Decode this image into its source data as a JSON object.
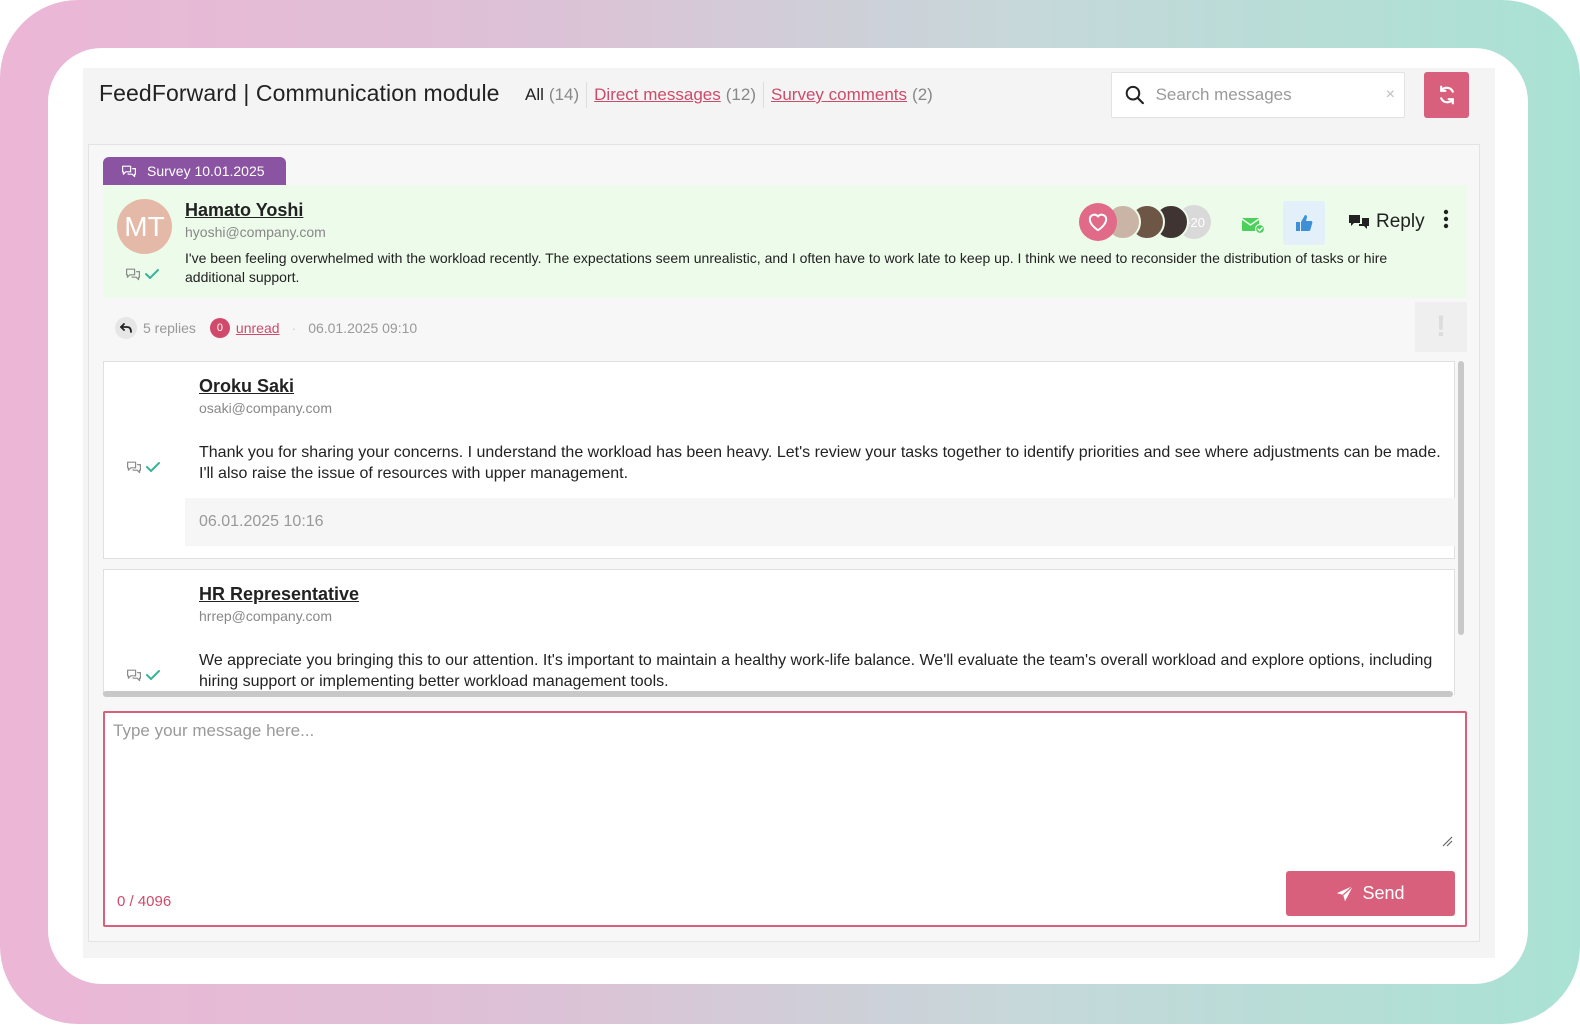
{
  "app": {
    "title": "FeedForward | Communication module"
  },
  "tabs": [
    {
      "label": "All",
      "count": "(14)"
    },
    {
      "label": "Direct messages",
      "count": "(12)"
    },
    {
      "label": "Survey comments",
      "count": "(2)"
    }
  ],
  "search": {
    "placeholder": "Search messages",
    "clear_symbol": "×"
  },
  "colors": {
    "accent": "#d8607c",
    "survey_tag": "#8a54a2",
    "top_msg_bg": "#edfbea",
    "link": "#cc4b6b"
  },
  "thread": {
    "survey_tag": "Survey 10.01.2025",
    "message": {
      "avatar_initials": "MT",
      "author_name": "Hamato Yoshi",
      "author_email": "hyoshi@company.com",
      "text": "I've been feeling overwhelmed with the workload recently. The expectations seem unrealistic, and I often have to work late to keep up. I think we need to reconsider the distribution of tasks or hire additional support.",
      "reactions_more": "+20",
      "reply_label": "Reply",
      "icons": [
        "heart-icon",
        "mail-check-icon",
        "thumbs-up-icon",
        "comments-icon",
        "kebab-icon",
        "chat-check-icon"
      ]
    },
    "meta": {
      "replies_text": "5 replies",
      "unread_count": "0",
      "unread_label": "unread",
      "timestamp": "06.01.2025 09:10",
      "flag_symbol": "!"
    },
    "replies": [
      {
        "author_name": "Oroku Saki",
        "author_email": "osaki@company.com",
        "text": "Thank you for sharing your concerns. I understand the workload has been heavy. Let's review your tasks together to identify priorities and see where adjustments can be made. I'll also raise the issue of resources with upper management.",
        "timestamp": "06.01.2025 10:16"
      },
      {
        "author_name": "HR Representative",
        "author_email": "hrrep@company.com",
        "text": "We appreciate you bringing this to our attention. It's important to maintain a healthy work-life balance. We'll evaluate the team's overall workload and explore options, including hiring support or implementing better workload management tools."
      }
    ]
  },
  "composer": {
    "placeholder": "Type your message here...",
    "char_count": "0 / 4096",
    "send_label": "Send"
  }
}
